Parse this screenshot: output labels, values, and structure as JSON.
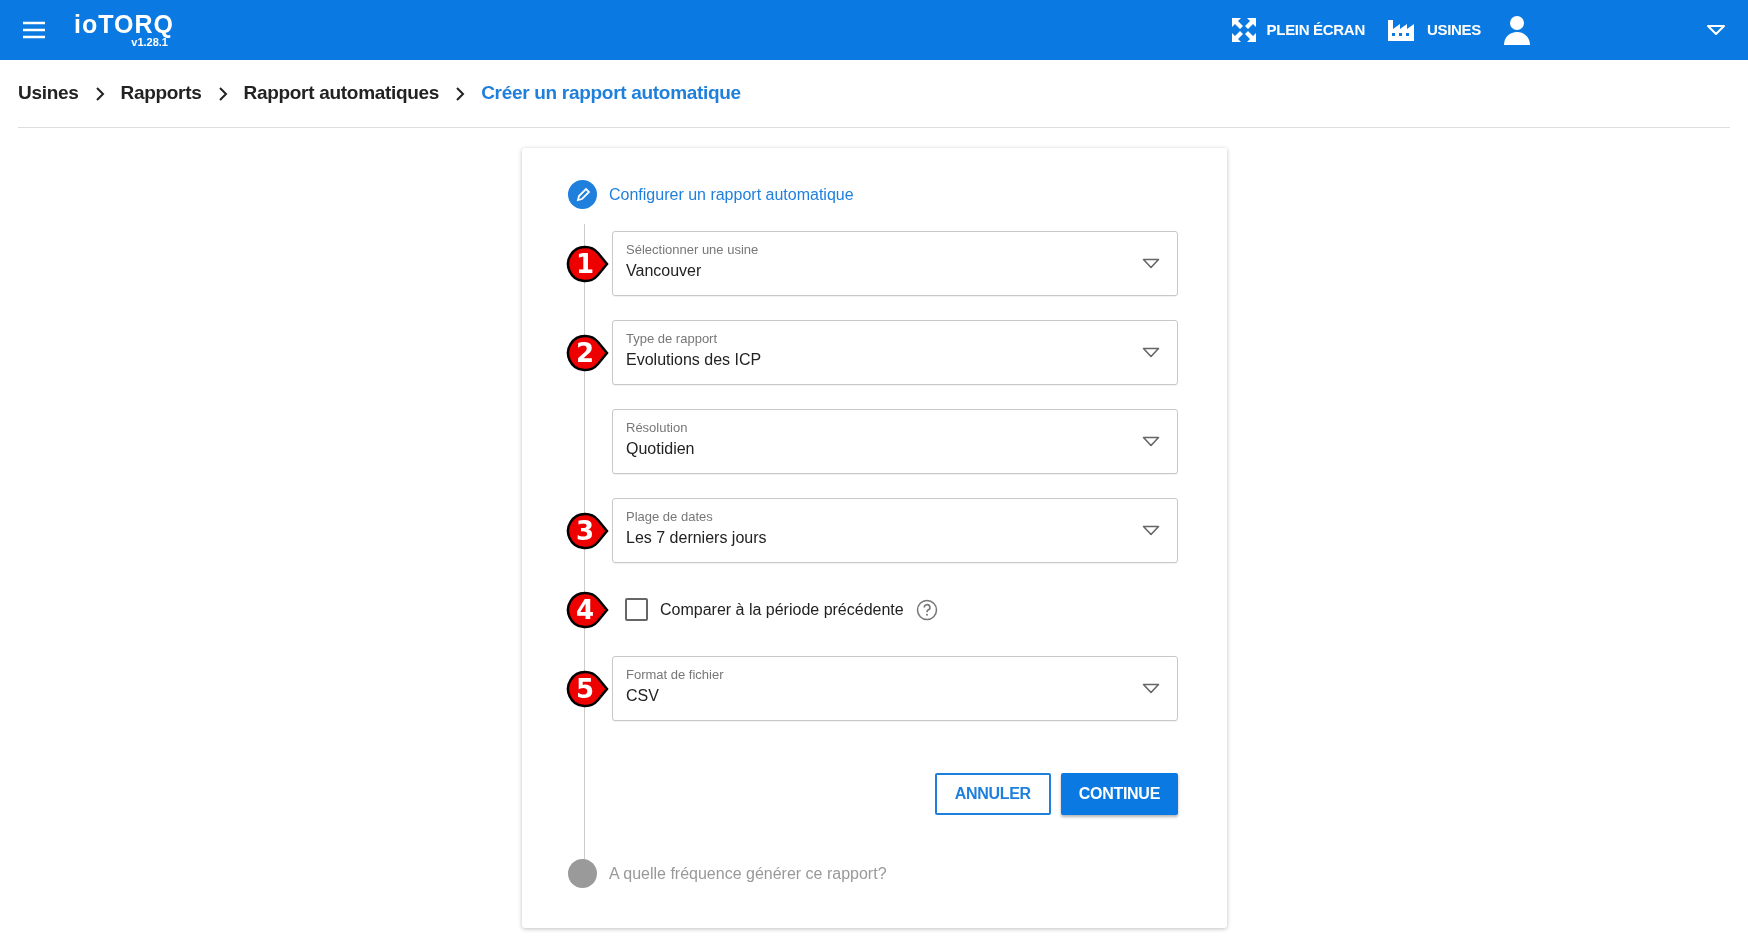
{
  "header": {
    "logo": "ioTORQ",
    "version": "v1.28.1",
    "actions": [
      {
        "kind": "fullscreen",
        "label": "PLEIN ÉCRAN"
      },
      {
        "kind": "factory",
        "label": "USINES"
      }
    ]
  },
  "breadcrumb": [
    {
      "label": "Usines",
      "current": false
    },
    {
      "label": "Rapports",
      "current": false
    },
    {
      "label": "Rapport automatiques",
      "current": false
    },
    {
      "label": "Créer un rapport automatique",
      "current": true
    }
  ],
  "steps": [
    {
      "title": "Configurer un rapport automatique",
      "active": true
    },
    {
      "title": "A quelle fréquence générer ce rapport?",
      "active": false
    }
  ],
  "form": [
    {
      "kind": "select",
      "marker": "1",
      "label": "Sélectionner une usine",
      "value": "Vancouver"
    },
    {
      "kind": "select",
      "marker": "2",
      "label": "Type de rapport",
      "value": "Evolutions des ICP"
    },
    {
      "kind": "select",
      "label": "Résolution",
      "value": "Quotidien"
    },
    {
      "kind": "select",
      "marker": "3",
      "label": "Plage de dates",
      "value": "Les 7 derniers jours"
    },
    {
      "kind": "checkbox",
      "marker": "4",
      "label": "Comparer à la période précédente",
      "checked": false
    },
    {
      "kind": "select",
      "marker": "5",
      "label": "Format de fichier",
      "value": "CSV"
    }
  ],
  "buttons": [
    {
      "kind": "outline",
      "label": "ANNULER"
    },
    {
      "kind": "primary",
      "label": "CONTINUE"
    }
  ]
}
